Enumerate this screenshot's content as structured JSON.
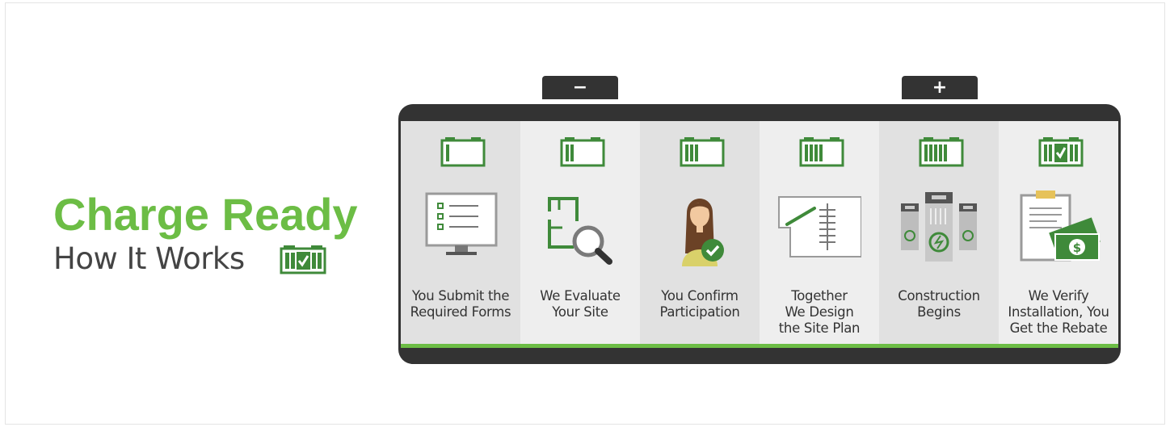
{
  "header": {
    "title": "Charge Ready",
    "subtitle": "How It Works"
  },
  "terminals": {
    "negative": "−",
    "positive": "+"
  },
  "colors": {
    "brand_green": "#6cbd45",
    "icon_green": "#3f8a3a",
    "dark": "#333333"
  },
  "steps": [
    {
      "label": "You Submit the\nRequired Forms",
      "charge_bars": 1,
      "icon": "monitor-checklist-icon"
    },
    {
      "label": "We Evaluate\nYour Site",
      "charge_bars": 2,
      "icon": "floorplan-magnifier-icon"
    },
    {
      "label": "You Confirm\nParticipation",
      "charge_bars": 3,
      "icon": "person-checkmark-icon"
    },
    {
      "label": "Together\nWe Design\nthe Site Plan",
      "charge_bars": 4,
      "icon": "site-plan-icon"
    },
    {
      "label": "Construction\nBegins",
      "charge_bars": 5,
      "icon": "chargers-icon"
    },
    {
      "label": "We Verify\nInstallation, You\nGet the Rebate",
      "charge_bars": 6,
      "icon": "clipboard-money-icon"
    }
  ]
}
